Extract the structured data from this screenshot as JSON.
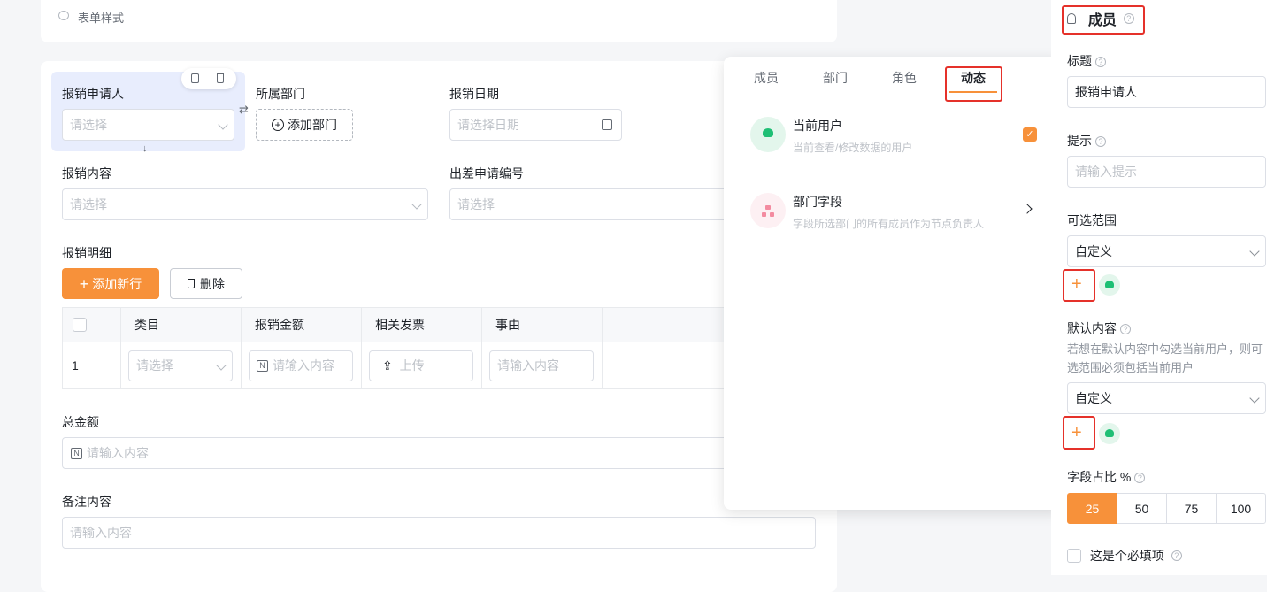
{
  "top_card": {
    "form_style": "表单样式"
  },
  "form": {
    "applicant": {
      "label": "报销申请人",
      "placeholder": "请选择"
    },
    "department": {
      "label": "所属部门",
      "add_label": "添加部门"
    },
    "date": {
      "label": "报销日期",
      "placeholder": "请选择日期"
    },
    "content": {
      "label": "报销内容",
      "placeholder": "请选择"
    },
    "trip_no": {
      "label": "出差申请编号",
      "placeholder": "请选择"
    },
    "details": {
      "label": "报销明细",
      "add_row": "添加新行",
      "delete": "删除",
      "columns": [
        "类目",
        "报销金额",
        "相关发票",
        "事由"
      ],
      "row": {
        "index": "1",
        "category": "请选择",
        "amount": "请输入内容",
        "invoice": "上传",
        "reason": "请输入内容"
      }
    },
    "total": {
      "label": "总金额",
      "placeholder": "请输入内容"
    },
    "remark": {
      "label": "备注内容",
      "placeholder": "请输入内容"
    }
  },
  "popover": {
    "tabs": [
      "成员",
      "部门",
      "角色",
      "动态"
    ],
    "active_tab": "动态",
    "items": [
      {
        "title": "当前用户",
        "desc": "当前查看/修改数据的用户",
        "checked": true
      },
      {
        "title": "部门字段",
        "desc": "字段所选部门的所有成员作为节点负责人"
      }
    ]
  },
  "panel": {
    "title": "成员",
    "title_label": "标题",
    "title_value": "报销申请人",
    "hint_label": "提示",
    "hint_placeholder": "请输入提示",
    "range_label": "可选范围",
    "range_value": "自定义",
    "default_label": "默认内容",
    "default_note": "若想在默认内容中勾选当前用户，则可选范围必须包括当前用户",
    "default_value": "自定义",
    "ratio_label": "字段占比 %",
    "ratio_options": [
      "25",
      "50",
      "75",
      "100"
    ],
    "ratio_selected": "25",
    "required_label": "这是个必填项"
  },
  "colors": {
    "accent": "#f7913a",
    "highlight": "#e8edfd",
    "avatar": "#1fbf75",
    "annotation": "#e5312a"
  }
}
